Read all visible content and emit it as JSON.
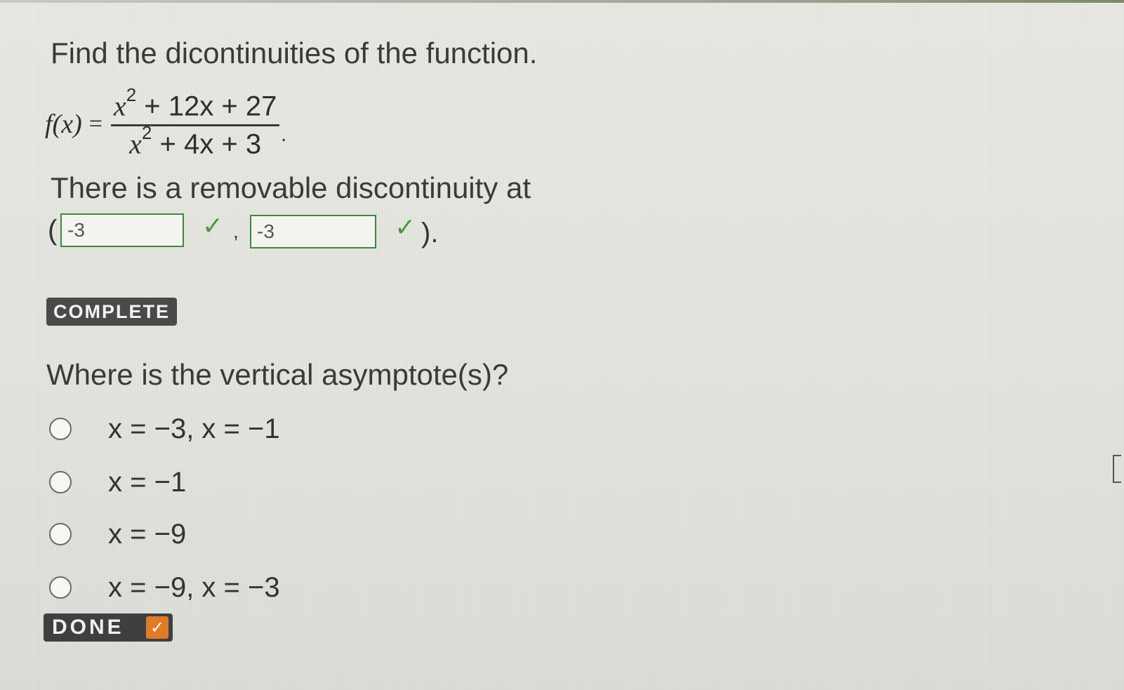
{
  "question": "Find the dicontinuities of the function.",
  "function": {
    "name": "f(x)",
    "equals": "=",
    "numerator": "+ 12x + 27",
    "denominator": "+ 4x + 3",
    "var": "x",
    "exponent": "2",
    "end_punct": "."
  },
  "removable": {
    "text": "There is a removable discontinuity at",
    "open_paren": "(",
    "comma": ",",
    "close_paren": ").",
    "x_value": "-3",
    "y_value": "-3",
    "check_glyph": "✓"
  },
  "complete_label": "COMPLETE",
  "asymptote": {
    "question": "Where is the vertical asymptote(s)?",
    "options": [
      "x = −3, x = −1",
      "x = −1",
      "x = −9",
      "x = −9, x = −3"
    ]
  },
  "done_label": "DONE",
  "done_check": "✓",
  "colors": {
    "correct_green": "#4a9a3a",
    "done_orange": "#e07b28",
    "badge_dark": "#4a4a4a"
  }
}
